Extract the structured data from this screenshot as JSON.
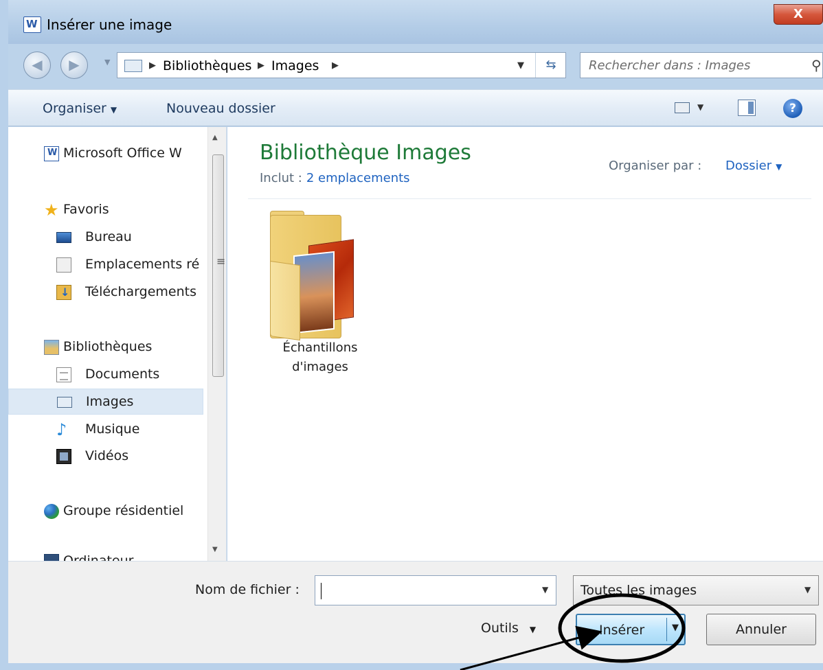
{
  "window": {
    "title": "Insérer une image",
    "close_glyph": "X"
  },
  "nav": {
    "breadcrumb": [
      "Bibliothèques",
      "Images"
    ],
    "search_placeholder": "Rechercher dans : Images"
  },
  "command_bar": {
    "organize": "Organiser",
    "new_folder": "Nouveau dossier",
    "help": "?"
  },
  "sidebar": {
    "items": [
      {
        "label": "Microsoft Office W",
        "icon": "office-icon"
      },
      {
        "label": "Favoris",
        "icon": "star-icon"
      },
      {
        "label": "Bureau",
        "icon": "desktop-icon"
      },
      {
        "label": "Emplacements ré",
        "icon": "places-icon"
      },
      {
        "label": "Téléchargements",
        "icon": "downloads-icon"
      },
      {
        "label": "Bibliothèques",
        "icon": "library-icon"
      },
      {
        "label": "Documents",
        "icon": "document-icon"
      },
      {
        "label": "Images",
        "icon": "images-icon",
        "selected": true
      },
      {
        "label": "Musique",
        "icon": "music-icon"
      },
      {
        "label": "Vidéos",
        "icon": "video-icon"
      },
      {
        "label": "Groupe résidentiel",
        "icon": "homegroup-icon"
      },
      {
        "label": "Ordinateur",
        "icon": "computer-icon"
      }
    ]
  },
  "content": {
    "title": "Bibliothèque Images",
    "includes_label": "Inclut :",
    "includes_link": "2 emplacements",
    "arrange_label": "Organiser par :",
    "arrange_value": "Dossier",
    "folder_line1": "Échantillons",
    "folder_line2": "d'images"
  },
  "footer": {
    "filename_label": "Nom de fichier :",
    "filename_value": "",
    "filter_value": "Toutes les images",
    "tools": "Outils",
    "insert": "Insérer",
    "cancel": "Annuler"
  },
  "colors": {
    "library_title": "#1e7a38",
    "link": "#1f63c0",
    "insert_border": "#3c7fb1"
  }
}
